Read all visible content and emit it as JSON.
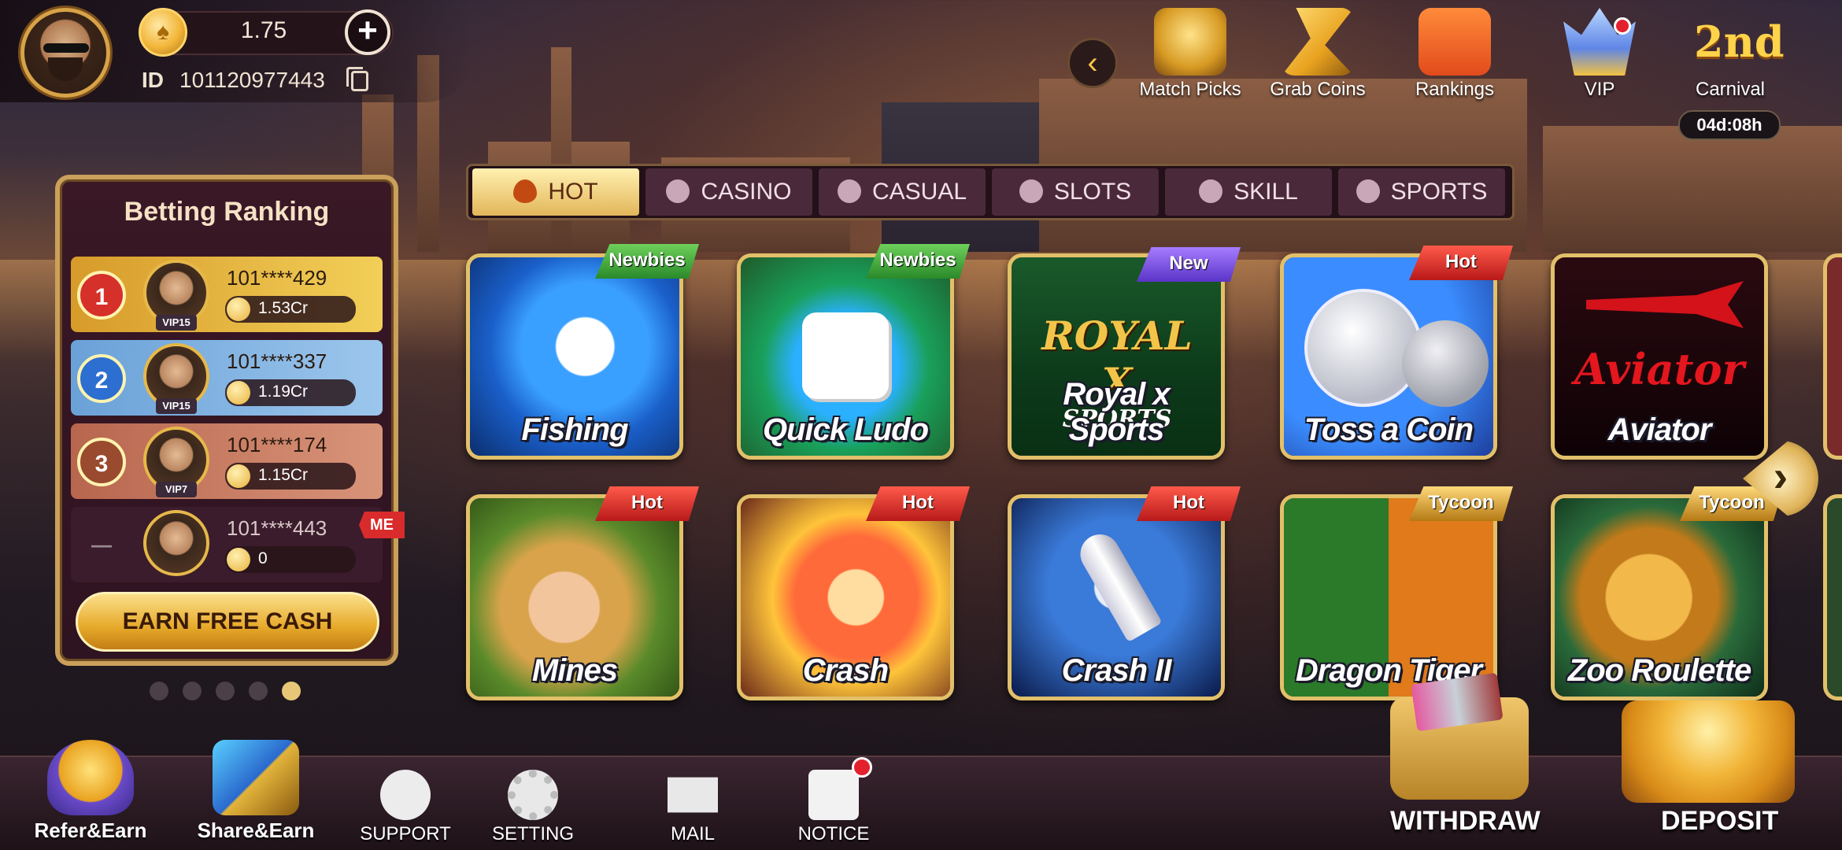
{
  "profile": {
    "balance": "1.75",
    "plus": "+",
    "id_label": "ID",
    "id_value": "101120977443"
  },
  "top_icons": [
    {
      "label": "Match Picks",
      "icon": "trophy-icon"
    },
    {
      "label": "Grab Coins",
      "icon": "grab-coins-icon"
    },
    {
      "label": "Rankings",
      "icon": "rankings-icon"
    },
    {
      "label": "VIP",
      "icon": "vip-crown-icon"
    },
    {
      "label": "Carnival",
      "icon": "carnival-icon",
      "badge": "2nd",
      "timer": "04d:08h"
    }
  ],
  "ranking": {
    "title": "Betting Ranking",
    "rows": [
      {
        "rank": "1",
        "name": "101****429",
        "vip": "VIP15",
        "amount": "1.53Cr"
      },
      {
        "rank": "2",
        "name": "101****337",
        "vip": "VIP15",
        "amount": "1.19Cr"
      },
      {
        "rank": "3",
        "name": "101****174",
        "vip": "VIP7",
        "amount": "1.15Cr"
      },
      {
        "rank": "—",
        "name": "101****443",
        "vip": "",
        "amount": "0",
        "me": "ME"
      }
    ],
    "earn_button": "EARN FREE CASH"
  },
  "tabs": [
    {
      "label": "HOT",
      "active": true
    },
    {
      "label": "CASINO"
    },
    {
      "label": "CASUAL"
    },
    {
      "label": "SLOTS"
    },
    {
      "label": "SKILL"
    },
    {
      "label": "SPORTS"
    }
  ],
  "games": [
    {
      "name": "Fishing",
      "tag": "Newbies"
    },
    {
      "name": "Quick Ludo",
      "tag": "Newbies"
    },
    {
      "name": "Royal x Sports",
      "tag": "New",
      "logo": "ROYAL X",
      "logo_sub": "SPORTS"
    },
    {
      "name": "Toss a Coin",
      "tag": "Hot"
    },
    {
      "name": "Aviator",
      "tag": "",
      "logo": "Aviator"
    },
    {
      "name": "Mines",
      "tag": "Hot"
    },
    {
      "name": "Crash",
      "tag": "Hot"
    },
    {
      "name": "Crash II",
      "tag": "Hot"
    },
    {
      "name": "Dragon Tiger",
      "tag": "Tycoon"
    },
    {
      "name": "Zoo Roulette",
      "tag": "Tycoon"
    }
  ],
  "bottom_nav": [
    {
      "label": "Refer&Earn"
    },
    {
      "label": "Share&Earn"
    },
    {
      "label": "SUPPORT"
    },
    {
      "label": "SETTING"
    },
    {
      "label": "MAIL"
    },
    {
      "label": "NOTICE"
    }
  ],
  "actions": {
    "withdraw": "WITHDRAW",
    "deposit": "DEPOSIT"
  }
}
